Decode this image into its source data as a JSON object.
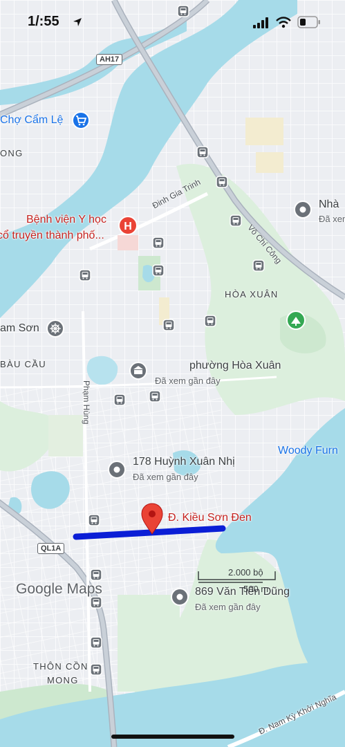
{
  "status_bar": {
    "time": "1/:55"
  },
  "highway_shields": {
    "ah17": "AH17",
    "ql1a": "QL1A"
  },
  "pois": {
    "cho_cam_le": "Chợ Cẩm Lệ",
    "hospital_line1": "Bệnh viện Y học",
    "hospital_line2": "cổ truyền thành phố...",
    "nha": "Nhà",
    "nha_sub": "Đã xem",
    "nam_son": "am Sơn",
    "phuong_hoa_xuan": "phường Hòa Xuân",
    "phuong_hoa_xuan_sub": "Đã xem gần đây",
    "woody": "Woody Furn",
    "huynh_xuan_nhi": "178 Huỳnh Xuân Nhị",
    "huynh_xuan_nhi_sub": "Đã xem gần đây",
    "kieu_son_den": "Đ. Kiều Sơn Đen",
    "van_tien_dung": "869 Văn Tiến Dũng",
    "van_tien_dung_sub": "Đã xem gần đây"
  },
  "areas": {
    "ong": "ONG",
    "hoa_xuan": "HÒA XUÂN",
    "bau_cau": "BÀU CẦU",
    "thon_con_line1": "THÔN CỒN",
    "thon_con_line2": "MONG"
  },
  "streets": {
    "dinh_gia_trinh": "Đinh Gia Trinh",
    "vo_chi_cong": "Võ Chí Công",
    "pham_hung": "Phạm Hùng",
    "nam_ky_khoi_nghia": "Đ. Nam Kỳ Khởi Nghĩa"
  },
  "scale": {
    "imperial": "2.000 bộ",
    "metric": "500 m"
  },
  "branding": {
    "logo": "Google Maps"
  },
  "icons": [
    "location-arrow-icon",
    "signal-icon",
    "wifi-icon",
    "battery-icon",
    "bus-stop-icon",
    "shopping-cart-icon",
    "hospital-icon",
    "place-pin-icon",
    "wheel-icon",
    "monument-icon",
    "park-icon",
    "red-pin-icon"
  ],
  "colors": {
    "water": "#a6dbe9",
    "park": "#d3ecd6",
    "route": "#0b1ed6",
    "pin": "#ea4335",
    "bus": "#5f6368"
  }
}
